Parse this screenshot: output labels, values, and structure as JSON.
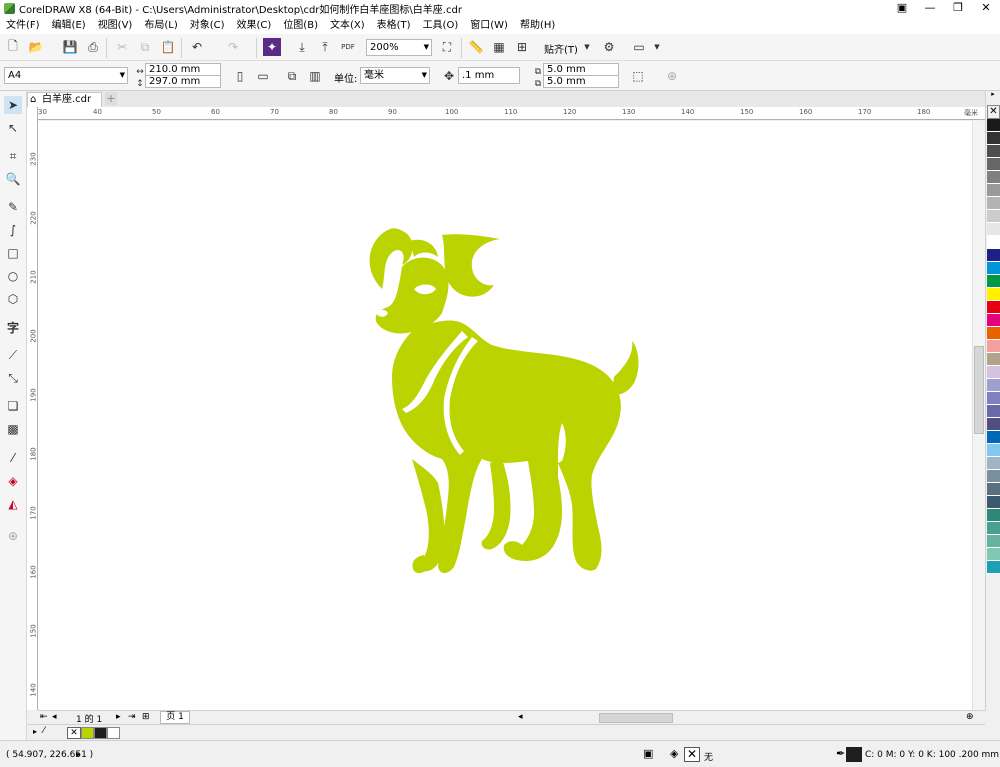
{
  "window": {
    "title": "CorelDRAW X8 (64-Bit) - C:\\Users\\Administrator\\Desktop\\cdr如何制作白羊座图标\\白羊座.cdr"
  },
  "menu": [
    "文件(F)",
    "编辑(E)",
    "视图(V)",
    "布局(L)",
    "对象(C)",
    "效果(C)",
    "位图(B)",
    "文本(X)",
    "表格(T)",
    "工具(O)",
    "窗口(W)",
    "帮助(H)"
  ],
  "toolbar": {
    "zoom": "200%",
    "snap_label": "贴齐(T)",
    "pdf_label": "PDF"
  },
  "property_bar": {
    "page_size": "A4",
    "width": "210.0 mm",
    "height": "297.0 mm",
    "unit_label": "单位:",
    "unit": "毫米",
    "nudge": ".1 mm",
    "dup_x": "5.0 mm",
    "dup_y": "5.0 mm"
  },
  "document_tab": {
    "label": "白羊座.cdr"
  },
  "ruler": {
    "h_ticks": [
      "30",
      "40",
      "50",
      "60",
      "70",
      "80",
      "90",
      "100",
      "110",
      "120",
      "130",
      "140",
      "150",
      "160",
      "170",
      "180"
    ],
    "h_unit": "毫米",
    "v_ticks": [
      "230",
      "220",
      "210",
      "200",
      "190",
      "180",
      "170",
      "160",
      "150",
      "140"
    ]
  },
  "page_nav": {
    "counter": "1 的 1",
    "page_tab": "页 1"
  },
  "status": {
    "coords": "( 54.907, 226.651 )",
    "fill_label": "无",
    "outline_info": "C: 0 M: 0 Y: 0 K: 100  .200 mm"
  },
  "colors": {
    "ram_fill": "#bbd300",
    "doc_palette": [
      "#bbd300",
      "#1e1e1e",
      "#ffffff"
    ],
    "palette": [
      "#1a1a1a",
      "#333333",
      "#4d4d4d",
      "#666666",
      "#808080",
      "#999999",
      "#b3b3b3",
      "#cccccc",
      "#e6e6e6",
      "#ffffff",
      "#1d2088",
      "#0095d9",
      "#009944",
      "#fff100",
      "#e60012",
      "#e4007f",
      "#eb6100",
      "#f5a0a0",
      "#b2a48c",
      "#d3c3e0",
      "#a0a0d0",
      "#8080c0",
      "#6a6aa8",
      "#505080",
      "#0068b7",
      "#80c8f0",
      "#a0b4c8",
      "#7890a0",
      "#5a7080",
      "#3c5a6e",
      "#2c8878",
      "#4aa090",
      "#66b4a0",
      "#80c8b4",
      "#1ea0b4"
    ]
  }
}
